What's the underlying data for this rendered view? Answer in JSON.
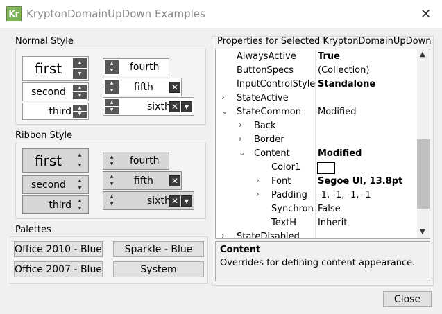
{
  "window": {
    "title": "KryptonDomainUpDown Examples",
    "icon_text": "Kr"
  },
  "normal": {
    "label": "Normal Style",
    "items": [
      "first",
      "second",
      "third",
      "fourth",
      "fifth",
      "sixth"
    ]
  },
  "ribbon": {
    "label": "Ribbon Style",
    "items": [
      "first",
      "second",
      "third",
      "fourth",
      "fifth",
      "sixth"
    ]
  },
  "palettes": {
    "label": "Palettes",
    "buttons": [
      "Office 2010 - Blue",
      "Sparkle - Blue",
      "Office 2007 - Blue",
      "System"
    ]
  },
  "properties": {
    "label": "Properties for Selected KryptonDomainUpDown",
    "rows": [
      {
        "name": "AlwaysActive",
        "value": "True",
        "bold": true
      },
      {
        "name": "ButtonSpecs",
        "value": "(Collection)"
      },
      {
        "name": "InputControlStyle",
        "value": "Standalone",
        "bold": true
      },
      {
        "name": "StateActive",
        "value": ""
      },
      {
        "name": "StateCommon",
        "value": "Modified"
      },
      {
        "name": "Back",
        "value": ""
      },
      {
        "name": "Border",
        "value": ""
      },
      {
        "name": "Content",
        "value": "Modified",
        "bold": true
      },
      {
        "name": "Color1",
        "value": ""
      },
      {
        "name": "Font",
        "value": "Segoe UI, 13.8pt",
        "bold": true
      },
      {
        "name": "Padding",
        "value": "-1, -1, -1, -1"
      },
      {
        "name": "Synchroni",
        "value": "False"
      },
      {
        "name": "TextH",
        "value": "Inherit"
      },
      {
        "name": "StateDisabled",
        "value": ""
      }
    ],
    "desc_title": "Content",
    "desc_text": "Overrides for defining content appearance."
  },
  "close_label": "Close"
}
